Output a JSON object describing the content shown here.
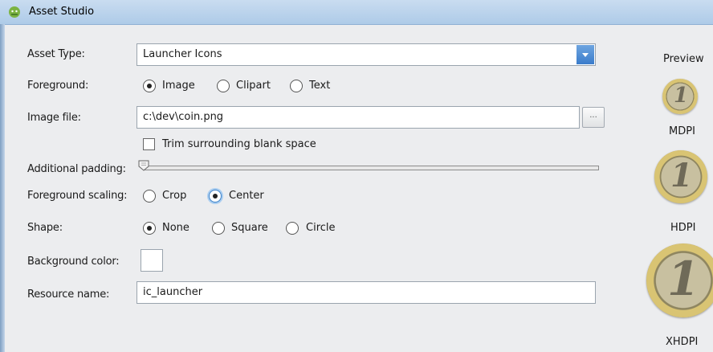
{
  "window": {
    "title": "Asset Studio"
  },
  "form": {
    "asset_type": {
      "label": "Asset Type:",
      "value": "Launcher Icons"
    },
    "foreground": {
      "label": "Foreground:",
      "options": [
        "Image",
        "Clipart",
        "Text"
      ],
      "selected": "Image"
    },
    "image_file": {
      "label": "Image file:",
      "value": "c:\\dev\\coin.png",
      "browse_label": "..."
    },
    "trim": {
      "label": "Trim surrounding blank space",
      "checked": false
    },
    "padding": {
      "label": "Additional padding:",
      "value_fraction": 0
    },
    "scaling": {
      "label": "Foreground scaling:",
      "options": [
        "Crop",
        "Center"
      ],
      "selected": "Center"
    },
    "shape": {
      "label": "Shape:",
      "options": [
        "None",
        "Square",
        "Circle"
      ],
      "selected": "None"
    },
    "background_color": {
      "label": "Background color:",
      "value": "#ffffff"
    },
    "resource_name": {
      "label": "Resource name:",
      "value": "ic_launcher"
    }
  },
  "preview": {
    "title": "Preview",
    "coin_text": "1",
    "items": [
      {
        "label": "MDPI"
      },
      {
        "label": "HDPI"
      },
      {
        "label": "XHDPI"
      }
    ]
  },
  "colors": {
    "title_bar": "#aecbe8",
    "window_bg": "#ecedef",
    "dropdown_accent": "#3a7ccb"
  }
}
